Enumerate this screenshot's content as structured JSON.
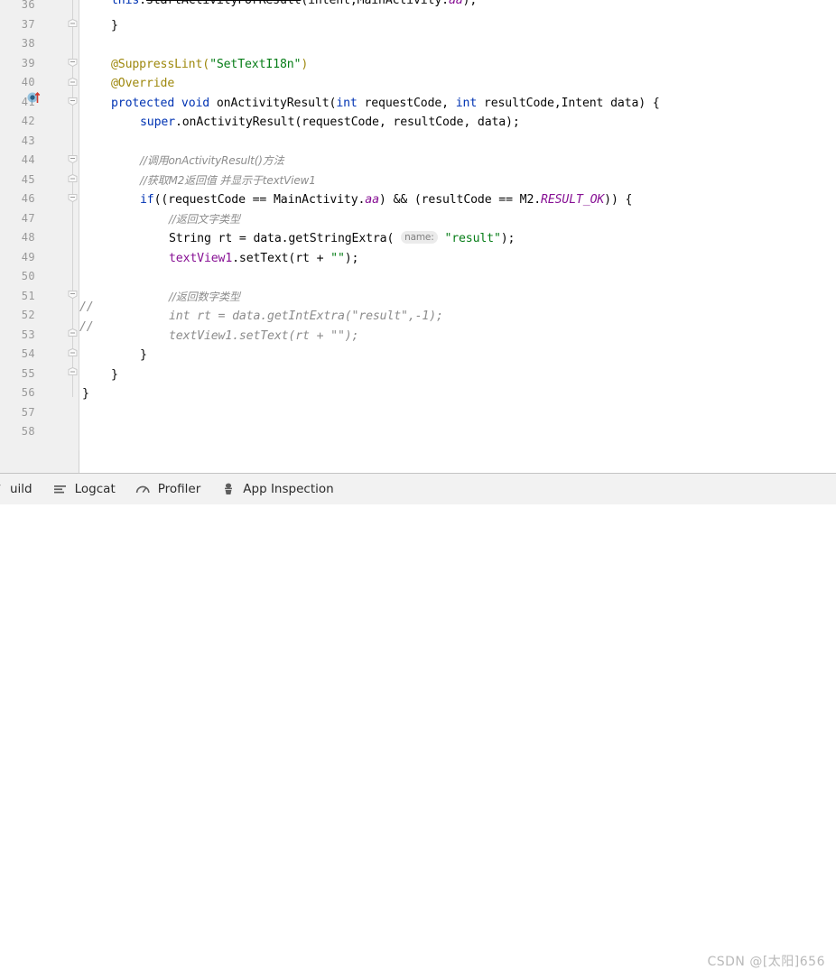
{
  "editor": {
    "first_visible_line": 36,
    "last_visible_line": 58,
    "line_numbers": [
      36,
      37,
      38,
      39,
      40,
      41,
      42,
      43,
      44,
      45,
      46,
      47,
      48,
      49,
      50,
      51,
      52,
      53,
      54,
      55,
      56,
      57,
      58
    ],
    "gutter_icons": [
      {
        "line": 41,
        "name": "override-method-marker",
        "color": "#3592c4"
      }
    ],
    "fold_markers": [
      {
        "line": 37,
        "type": "fold-end"
      },
      {
        "line": 39,
        "type": "fold-start"
      },
      {
        "line": 40,
        "type": "fold-end"
      },
      {
        "line": 41,
        "type": "fold-start"
      },
      {
        "line": 44,
        "type": "fold-start"
      },
      {
        "line": 45,
        "type": "fold-end"
      },
      {
        "line": 46,
        "type": "fold-start"
      },
      {
        "line": 51,
        "type": "fold-start"
      },
      {
        "line": 53,
        "type": "fold-end"
      },
      {
        "line": 54,
        "type": "fold-end"
      },
      {
        "line": 55,
        "type": "fold-end"
      }
    ],
    "commented_gutter_marks": [
      {
        "line": 52,
        "text": "//"
      },
      {
        "line": 53,
        "text": "//"
      }
    ],
    "inlay_hints": [
      {
        "line": 48,
        "text": "name:"
      }
    ],
    "lines": [
      {
        "n": 36,
        "text": "        this.startActivityForResult(intent,MainActivity.aa);"
      },
      {
        "n": 37,
        "text": "    }"
      },
      {
        "n": 38,
        "text": ""
      },
      {
        "n": 39,
        "text": "    @SuppressLint(\"SetTextI18n\")"
      },
      {
        "n": 40,
        "text": "    @Override"
      },
      {
        "n": 41,
        "text": "    protected void onActivityResult(int requestCode, int resultCode,Intent data) {"
      },
      {
        "n": 42,
        "text": "        super.onActivityResult(requestCode, resultCode, data);"
      },
      {
        "n": 43,
        "text": ""
      },
      {
        "n": 44,
        "text": "        //调用onActivityResult()方法"
      },
      {
        "n": 45,
        "text": "        //获取M2返回值 并显示于textView1"
      },
      {
        "n": 46,
        "text": "        if((requestCode == MainActivity.aa) && (resultCode == M2.RESULT_OK)) {"
      },
      {
        "n": 47,
        "text": "            //返回文字类型"
      },
      {
        "n": 48,
        "text": "            String rt = data.getStringExtra( name: \"result\");"
      },
      {
        "n": 49,
        "text": "            textView1.setText(rt + \"\");"
      },
      {
        "n": 50,
        "text": ""
      },
      {
        "n": 51,
        "text": "            //返回数字类型"
      },
      {
        "n": 52,
        "text": "            int rt = data.getIntExtra(\"result\",-1);"
      },
      {
        "n": 53,
        "text": "            textView1.setText(rt + \"\");"
      },
      {
        "n": 54,
        "text": "        }"
      },
      {
        "n": 55,
        "text": "    }"
      },
      {
        "n": 56,
        "text": "}"
      },
      {
        "n": 57,
        "text": ""
      },
      {
        "n": 58,
        "text": ""
      }
    ],
    "tokens": {
      "l36_this": "this",
      "l36_dot": ".",
      "l36_call": "startActivityForResult",
      "l36_args": "(intent,MainActivity.",
      "l36_field": "aa",
      "l36_end": ");",
      "l37": "}",
      "l39": "@SuppressLint(",
      "l39_str": "\"SetTextI18n\"",
      "l39_end": ")",
      "l40": "@Override",
      "l41_mod": "protected",
      "l41_void": "void",
      "l41_name": "onActivityResult(",
      "l41_int1": "int",
      "l41_p1": " requestCode, ",
      "l41_int2": "int",
      "l41_p2": " resultCode,Intent data) {",
      "l42_super": "super",
      "l42_rest": ".onActivityResult(requestCode, resultCode, data);",
      "l44": "//调用onActivityResult()方法",
      "l45": "//获取M2返回值 并显示于textView1",
      "l46_if": "if",
      "l46_a": "((requestCode == MainActivity.",
      "l46_aa": "aa",
      "l46_b": ") && (resultCode == M2.",
      "l46_ok": "RESULT_OK",
      "l46_c": ")) {",
      "l47": "//返回文字类型",
      "l48_a": "String rt = data.getStringExtra( ",
      "l48_hint": "name:",
      "l48_str": "\"result\"",
      "l48_b": ");",
      "l49_fld": "textView1",
      "l49_a": ".setText(rt + ",
      "l49_str": "\"\"",
      "l49_b": ");",
      "l51": "//返回数字类型",
      "l52": "int rt = data.getIntExtra(\"result\",-1);",
      "l53": "textView1.setText(rt + \"\");",
      "l54": "}",
      "l55": "}",
      "l56": "}"
    }
  },
  "bottom_bar": {
    "tabs": [
      {
        "id": "build",
        "label": "uild",
        "icon": "build-icon",
        "clipped": true
      },
      {
        "id": "logcat",
        "label": "Logcat",
        "icon": "logcat-list-icon",
        "clipped": false
      },
      {
        "id": "profiler",
        "label": "Profiler",
        "icon": "profiler-gauge-icon",
        "clipped": false
      },
      {
        "id": "app-inspection",
        "label": "App Inspection",
        "icon": "app-inspection-icon",
        "clipped": false
      }
    ]
  },
  "watermark": {
    "text": "CSDN @[太阳]656"
  },
  "colors": {
    "keyword": "#0033b3",
    "string": "#067d17",
    "annotation": "#9e880d",
    "field": "#871094",
    "comment": "#8c8c8c",
    "gutter_bg": "#f0f0f0",
    "editor_bg": "#ffffff",
    "toolbar_bg": "#f2f2f2",
    "watermark": "#b9b9b9"
  }
}
